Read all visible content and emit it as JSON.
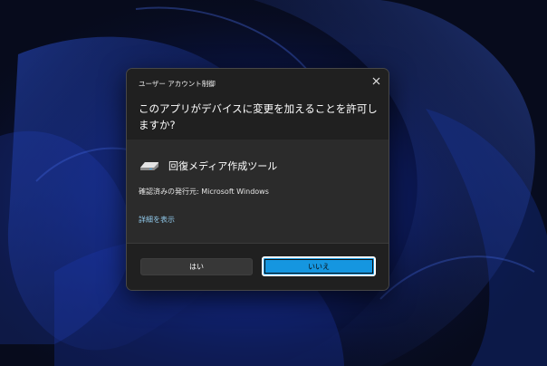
{
  "dialog": {
    "title": "ユーザー アカウント制御",
    "question": "このアプリがデバイスに変更を加えることを許可しますか?",
    "app_name": "回復メディア作成ツール",
    "publisher": "確認済みの発行元: Microsoft Windows",
    "details_link": "詳細を表示",
    "yes_label": "はい",
    "no_label": "いいえ"
  },
  "icons": {
    "close": "close-icon",
    "app": "drive-icon"
  },
  "colors": {
    "desktop_background": "#070b1c",
    "dialog_body": "#2b2b2b",
    "dialog_header": "#202020",
    "accent_button": "#1596e0",
    "link": "#8fc7e8"
  }
}
